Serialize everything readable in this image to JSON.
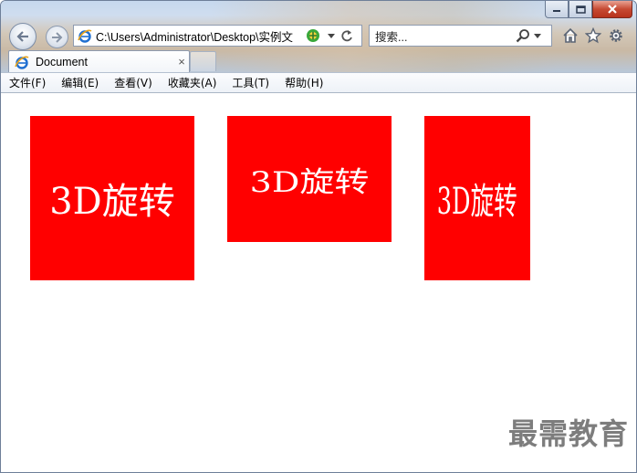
{
  "window": {
    "caption_buttons": [
      "minimize",
      "maximize",
      "close"
    ]
  },
  "toolbar": {
    "address": "C:\\Users\\Administrator\\Desktop\\实例文",
    "search_placeholder": "搜索...",
    "icons": [
      "back-arrow-icon",
      "forward-arrow-icon",
      "ie-page-icon",
      "compatibility-icon",
      "dropdown-icon",
      "refresh-icon",
      "search-icon",
      "home-icon",
      "favorites-star-icon",
      "gear-icon"
    ]
  },
  "tab": {
    "title": "Document",
    "close": "×"
  },
  "menu": {
    "items": [
      "文件(F)",
      "编辑(E)",
      "查看(V)",
      "收藏夹(A)",
      "工具(T)",
      "帮助(H)"
    ]
  },
  "content": {
    "box_color": "#ff0000",
    "boxes": [
      {
        "label": "3D旋转"
      },
      {
        "label": "3D旋转"
      },
      {
        "label": "3D旋转"
      }
    ]
  },
  "watermark": "最需教育"
}
